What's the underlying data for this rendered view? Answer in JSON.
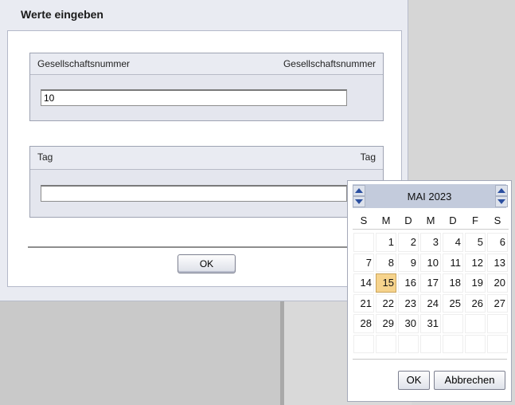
{
  "dialog": {
    "title": "Werte eingeben",
    "fields": [
      {
        "label": "Gesellschaftsnummer",
        "label_right": "Gesellschaftsnummer",
        "value": "10"
      },
      {
        "label": "Tag",
        "label_right": "Tag",
        "value": ""
      }
    ],
    "ok_label": "OK"
  },
  "calendar": {
    "month_year": "MAI  2023",
    "weekdays": [
      "S",
      "M",
      "D",
      "M",
      "D",
      "F",
      "S"
    ],
    "days": [
      "",
      "1",
      "2",
      "3",
      "4",
      "5",
      "6",
      "7",
      "8",
      "9",
      "10",
      "11",
      "12",
      "13",
      "14",
      "15",
      "16",
      "17",
      "18",
      "19",
      "20",
      "21",
      "22",
      "23",
      "24",
      "25",
      "26",
      "27",
      "28",
      "29",
      "30",
      "31",
      "",
      "",
      "",
      "",
      "",
      "",
      "",
      "",
      "",
      ""
    ],
    "selected_day": "15",
    "ok_label": "OK",
    "cancel_label": "Abbrechen",
    "highlight_color": "#f6d38c"
  }
}
